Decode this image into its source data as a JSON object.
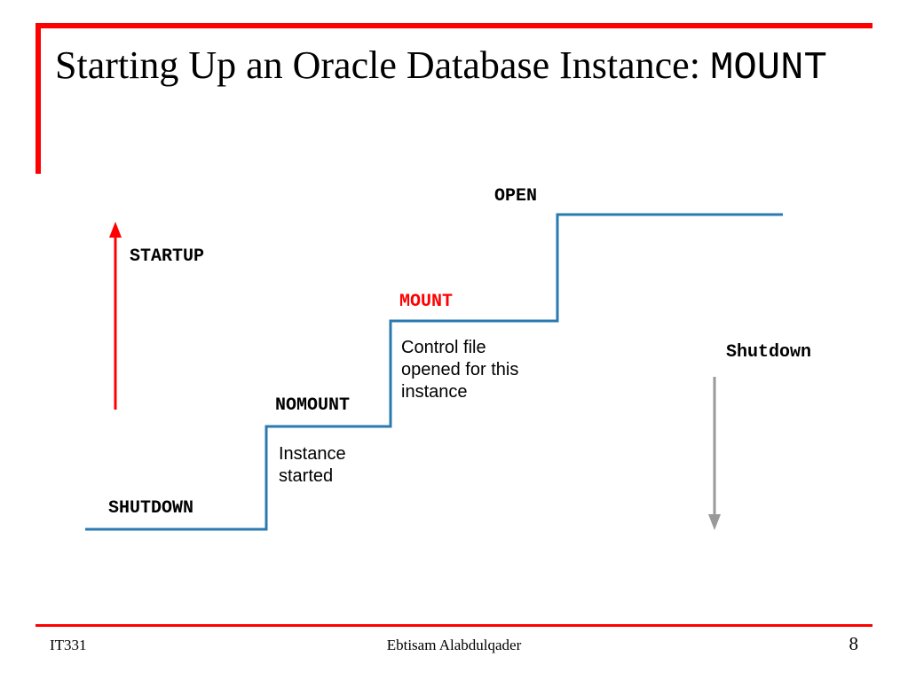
{
  "title": {
    "prefix": "Starting Up an Oracle Database Instance: ",
    "suffix": "MOUNT"
  },
  "stages": {
    "shutdown": "SHUTDOWN",
    "nomount": "NOMOUNT",
    "mount": "MOUNT",
    "open": "OPEN"
  },
  "descriptions": {
    "nomount": "Instance started",
    "mount": "Control file opened for this instance"
  },
  "arrows": {
    "startup": "STARTUP",
    "shutdown": "Shutdown"
  },
  "footer": {
    "left": "IT331",
    "center": "Ebtisam Alabdulqader",
    "right": "8"
  },
  "colors": {
    "accent_red": "#ff0000",
    "step_blue": "#2a7ab0",
    "arrow_grey": "#999999"
  }
}
